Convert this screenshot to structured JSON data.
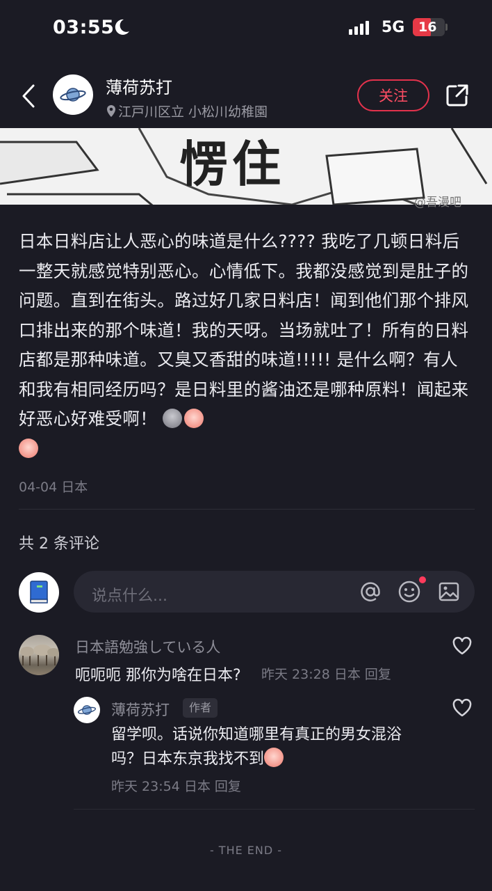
{
  "status_bar": {
    "time": "03:55",
    "network": "5G",
    "battery": "16"
  },
  "header": {
    "username": "薄荷苏打",
    "location": "江戸川区立 小松川幼稚園",
    "follow_label": "关注"
  },
  "photo": {
    "text": "愣住",
    "watermark": "@吾漫吧"
  },
  "post": {
    "body": "日本日料店让人恶心的味道是什么????  我吃了几顿日料后一整天就感觉特别恶心。心情低下。我都没感觉到是肚子的问题。直到在街头。路过好几家日料店！闻到他们那个排风口排出来的那个味道！我的天呀。当场就吐了！所有的日料店都是那种味道。又臭又香甜的味道!!!!!  是什么啊？有人和我有相同经历吗？是日料里的酱油还是哪种原料！闻起来好恶心好难受啊！",
    "meta": "04-04 日本"
  },
  "comments_section": {
    "count_label": "共 2 条评论",
    "input_placeholder": "说点什么..."
  },
  "comments": [
    {
      "name": "日本語勉強している人",
      "text": "呃呃呃 那你为啥在日本?",
      "meta": "昨天 23:28 日本 回复"
    },
    {
      "name": "薄荷苏打",
      "badge": "作者",
      "text": "留学呗。话说你知道哪里有真正的男女混浴吗？日本东京我找不到",
      "meta": "昨天 23:54 日本 回复"
    }
  ],
  "footer": {
    "end_label": "- THE END -"
  },
  "colors": {
    "accent": "#ff4d63",
    "background": "#1b1b24"
  }
}
